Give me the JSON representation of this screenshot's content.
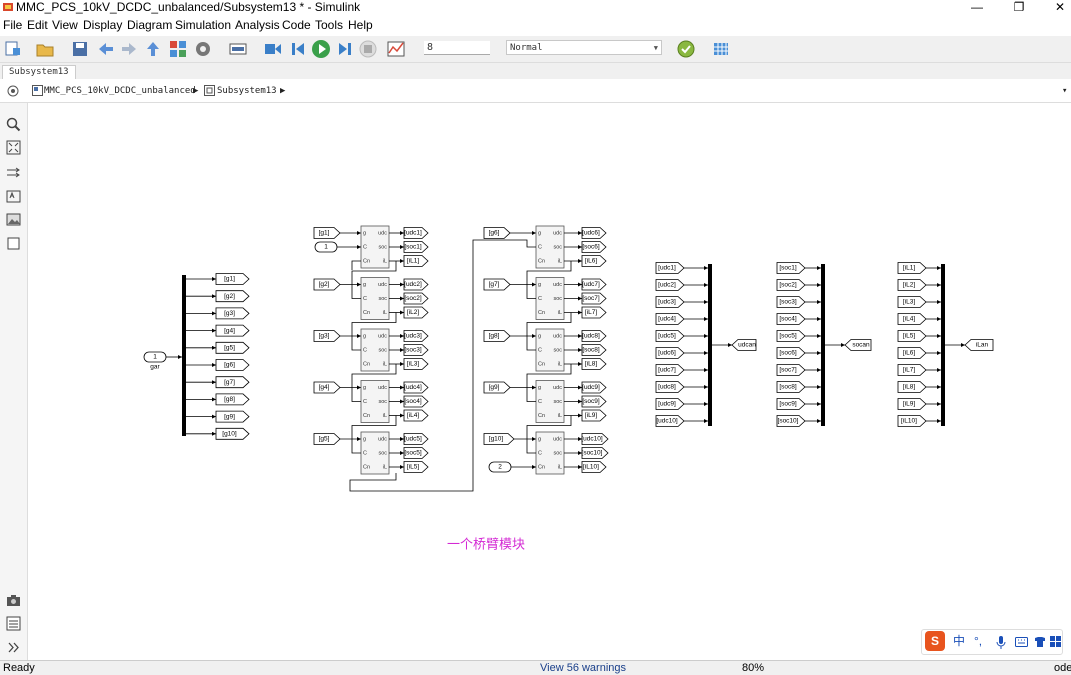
{
  "window": {
    "title": "MMC_PCS_10kV_DCDC_unbalanced/Subsystem13 * - Simulink",
    "controls": {
      "minimize": "—",
      "maximize": "❐",
      "close": "✕"
    }
  },
  "menu": [
    "File",
    "Edit",
    "View",
    "Display",
    "Diagram",
    "Simulation",
    "Analysis",
    "Code",
    "Tools",
    "Help"
  ],
  "toolbar": {
    "stop_time": "8",
    "sim_mode": "Normal",
    "icons": [
      "new-model-icon",
      "open-icon",
      "save-icon",
      "back-icon",
      "forward-icon",
      "up-icon",
      "library-icon",
      "settings-icon",
      "model-explorer-icon",
      "step-back-icon",
      "run-icon",
      "step-forward-icon",
      "stop-icon",
      "scope-icon",
      "check-icon",
      "grid-icon"
    ]
  },
  "tab": {
    "label": "Subsystem13"
  },
  "breadcrumb": {
    "model": "MMC_PCS_10kV_DCDC_unbalanced",
    "subsystem": "Subsystem13"
  },
  "diagram": {
    "input_port": {
      "number": "1",
      "label": "gar"
    },
    "demux_goto": [
      "[g1]",
      "[g2]",
      "[g3]",
      "[g4]",
      "[g5]",
      "[g6]",
      "[g7]",
      "[g8]",
      "[g9]",
      "[g10]"
    ],
    "block_ports": {
      "in": [
        "g",
        "C",
        "Cn"
      ],
      "out": [
        "udc",
        "soc",
        "iL"
      ]
    },
    "upper_arm": [
      {
        "from": "[g1]",
        "outs": [
          "[udc1]",
          "[soc1]",
          "[iL1]"
        ]
      },
      {
        "from": "[g2]",
        "outs": [
          "[udc2]",
          "[soc2]",
          "[iL2]"
        ]
      },
      {
        "from": "[g3]",
        "outs": [
          "[udc3]",
          "[soc3]",
          "[iL3]"
        ]
      },
      {
        "from": "[g4]",
        "outs": [
          "[udc4]",
          "[soc4]",
          "[iL4]"
        ]
      },
      {
        "from": "[g5]",
        "outs": [
          "[udc5]",
          "[soc5]",
          "[iL5]"
        ]
      }
    ],
    "lower_arm": [
      {
        "from": "[g6]",
        "outs": [
          "[udc6]",
          "[soc6]",
          "[iL6]"
        ]
      },
      {
        "from": "[g7]",
        "outs": [
          "[udc7]",
          "[soc7]",
          "[iL7]"
        ]
      },
      {
        "from": "[g8]",
        "outs": [
          "[udc8]",
          "[soc8]",
          "[iL8]"
        ]
      },
      {
        "from": "[g9]",
        "outs": [
          "[udc9]",
          "[soc9]",
          "[iL9]"
        ]
      },
      {
        "from": "[g10]",
        "outs": [
          "[udc10]",
          "[soc10]",
          "[iL10]"
        ]
      }
    ],
    "in_port_1": "1",
    "in_port_2": "2",
    "mux_udc": {
      "inputs": [
        "[udc1]",
        "[udc2]",
        "[udc3]",
        "[udc4]",
        "[udc5]",
        "[udc6]",
        "[udc7]",
        "[udc8]",
        "[udc9]",
        "[udc10]"
      ],
      "output": "udcan"
    },
    "mux_soc": {
      "inputs": [
        "[soc1]",
        "[soc2]",
        "[soc3]",
        "[soc4]",
        "[soc5]",
        "[soc6]",
        "[soc7]",
        "[soc8]",
        "[soc9]",
        "[soc10]"
      ],
      "output": "socan"
    },
    "mux_il": {
      "inputs": [
        "[iL1]",
        "[iL2]",
        "[iL3]",
        "[iL4]",
        "[iL5]",
        "[iL6]",
        "[iL7]",
        "[iL8]",
        "[iL9]",
        "[iL10]"
      ],
      "output": "iLan"
    },
    "annotation": "一个桥臂模块"
  },
  "status": {
    "left": "Ready",
    "warnings": "View 56 warnings",
    "zoom": "80%",
    "solver": "ode"
  },
  "ime": {
    "logo": "S",
    "lang": "中",
    "punct": "°,"
  }
}
